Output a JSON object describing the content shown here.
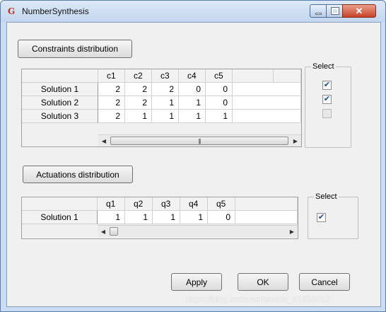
{
  "window": {
    "title": "NumberSynthesis",
    "icon": "app-logo-icon"
  },
  "constraints": {
    "button_label": "Constraints distribution",
    "columns": [
      "c1",
      "c2",
      "c3",
      "c4",
      "c5"
    ],
    "rows": [
      {
        "label": "Solution 1",
        "values": [
          "2",
          "2",
          "2",
          "0",
          "0"
        ],
        "selected": true
      },
      {
        "label": "Solution 2",
        "values": [
          "2",
          "2",
          "1",
          "1",
          "0"
        ],
        "selected": true
      },
      {
        "label": "Solution 3",
        "values": [
          "2",
          "1",
          "1",
          "1",
          "1"
        ],
        "selected": false
      }
    ],
    "select_label": "Select"
  },
  "actuations": {
    "button_label": "Actuations distribution",
    "columns": [
      "q1",
      "q2",
      "q3",
      "q4",
      "q5"
    ],
    "rows": [
      {
        "label": "Solution 1",
        "values": [
          "1",
          "1",
          "1",
          "1",
          "0"
        ],
        "selected": true
      }
    ],
    "select_label": "Select"
  },
  "footer": {
    "apply_label": "Apply",
    "ok_label": "OK",
    "cancel_label": "Cancel"
  },
  "watermark": "https://blog.csdn.net/weixin_41855010",
  "colors": {
    "titlebar": "#c9dcf2",
    "close_button": "#c7432a",
    "check": "#244c8c"
  }
}
